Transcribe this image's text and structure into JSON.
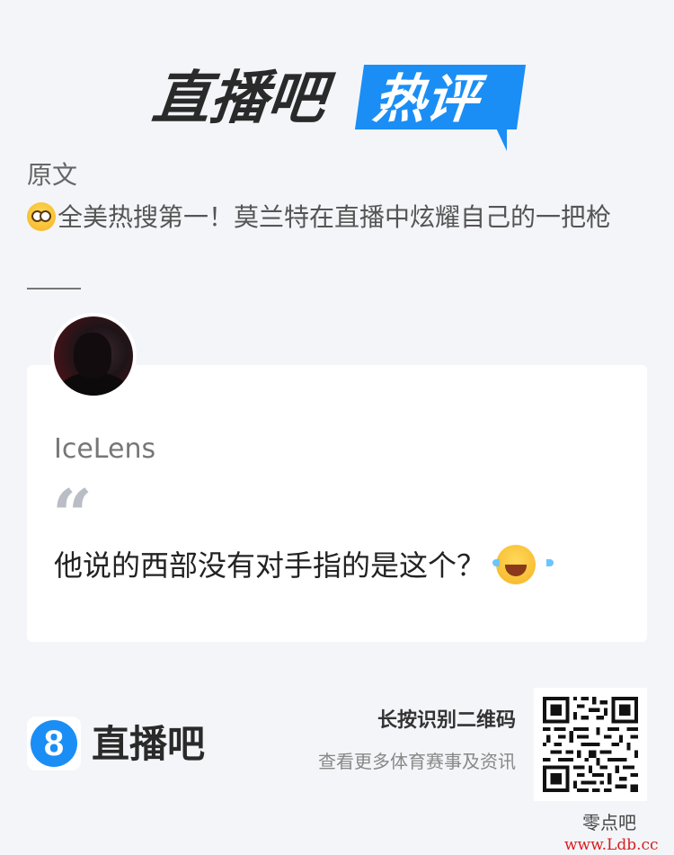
{
  "header": {
    "logo_dark": "直播吧",
    "logo_light": "热评"
  },
  "article": {
    "label": "原文",
    "title_emoji": "flushed-face-emoji",
    "title": "全美热搜第一！莫兰特在直播中炫耀自己的一把枪"
  },
  "comment": {
    "username": "IceLens",
    "quote_mark": "“",
    "text": "他说的西部没有对手指的是这个？",
    "trailing_emoji": "tears-of-joy-emoji"
  },
  "footer": {
    "logo_digit": "8",
    "brand": "直播吧",
    "scan_title": "长按识别二维码",
    "scan_subtitle": "查看更多体育赛事及资讯",
    "qr_icon": "qr-code"
  },
  "watermark": {
    "site_name": "零点吧",
    "url": "www.Ldb.cc"
  },
  "colors": {
    "brand_blue": "#1a8ef5",
    "background": "#f4f5f9",
    "watermark_red": "#d81e1e"
  }
}
